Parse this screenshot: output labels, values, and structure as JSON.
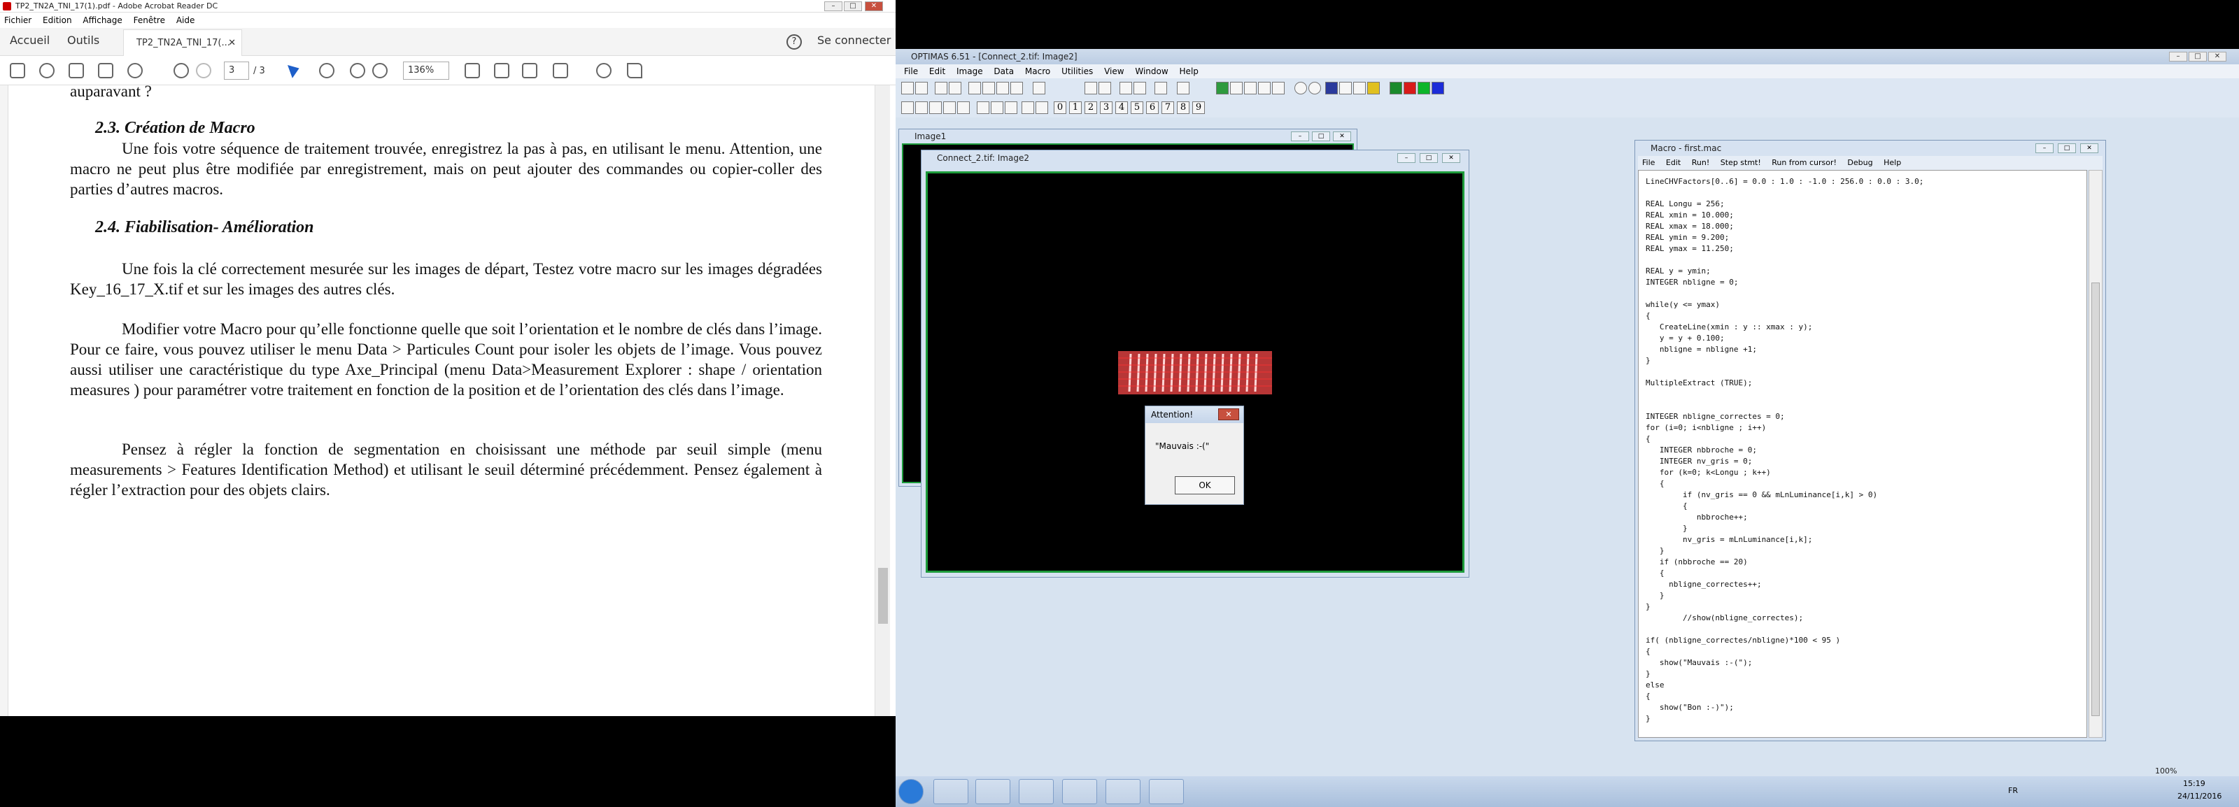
{
  "acrobat": {
    "title": "TP2_TN2A_TNI_17(1).pdf - Adobe Acrobat Reader DC",
    "menu": [
      "Fichier",
      "Edition",
      "Affichage",
      "Fenêtre",
      "Aide"
    ],
    "home_tab": "Accueil",
    "tools_tab": "Outils",
    "doc_tab": "TP2_TN2A_TNI_17(...",
    "signin": "Se connecter",
    "page_current": "3",
    "page_total": "/ 3",
    "zoom": "136%",
    "content": {
      "cut_top": "auparavant ?",
      "h1": "2.3. Création de Macro",
      "p1": "Une fois votre séquence de traitement trouvée, enregistrez la pas à pas, en utilisant le menu. Attention, une macro ne peut plus être modifiée par enregistrement, mais on peut ajouter des commandes ou copier-coller des parties d’autres macros.",
      "h2": "2.4. Fiabilisation- Amélioration",
      "p2": "Une fois la clé correctement mesurée sur les images de départ, Testez votre macro sur les images dégradées Key_16_17_X.tif et sur les images des autres clés.",
      "p3": "Modifier votre Macro pour qu’elle fonctionne quelle que soit l’orientation et le nombre de clés dans l’image. Pour ce faire, vous pouvez utiliser le menu Data > Particules Count pour isoler les objets de l’image. Vous pouvez aussi utiliser une caractéristique du type Axe_Principal (menu Data>Measurement Explorer : shape / orientation measures ) pour paramétrer votre traitement en fonction de la position et de l’orientation des clés dans l’image.",
      "p4": "Pensez à régler la fonction de segmentation en choisissant une méthode par seuil simple (menu measurements > Features Identification Method) et utilisant le seuil déterminé précédemment. Pensez également à régler l’extraction pour des objets clairs."
    }
  },
  "optimas": {
    "title": "OPTIMAS 6.51 - [Connect_2.tif: Image2]",
    "menu": [
      "File",
      "Edit",
      "Image",
      "Data",
      "Macro",
      "Utilities",
      "View",
      "Window",
      "Help"
    ],
    "num_buttons": [
      "0",
      "1",
      "2",
      "3",
      "4",
      "5",
      "6",
      "7",
      "8",
      "9"
    ],
    "image1_title": "Image1",
    "image2_title": "Connect_2.tif: Image2",
    "alert": {
      "title": "Attention!",
      "message": "\"Mauvais :-(\"",
      "ok": "OK"
    },
    "macro": {
      "title": "Macro - first.mac",
      "menu": [
        "File",
        "Edit",
        "Run!",
        "Step stmt!",
        "Run from cursor!",
        "Debug",
        "Help"
      ],
      "code": "LineCHVFactors[0..6] = 0.0 : 1.0 : -1.0 : 256.0 : 0.0 : 3.0;\n\nREAL Longu = 256;\nREAL xmin = 10.000;\nREAL xmax = 18.000;\nREAL ymin = 9.200;\nREAL ymax = 11.250;\n\nREAL y = ymin;\nINTEGER nbligne = 0;\n\nwhile(y <= ymax)\n{\n   CreateLine(xmin : y :: xmax : y);\n   y = y + 0.100;\n   nbligne = nbligne +1;\n}\n\nMultipleExtract (TRUE);\n\n\nINTEGER nbligne_correctes = 0;\nfor (i=0; i<nbligne ; i++)\n{\n   INTEGER nbbroche = 0;\n   INTEGER nv_gris = 0;\n   for (k=0; k<Longu ; k++)\n   {\n        if (nv_gris == 0 && mLnLuminance[i,k] > 0)\n        {\n           nbbroche++;\n        }\n        nv_gris = mLnLuminance[i,k];\n   }\n   if (nbbroche == 20)\n   {\n     nbligne_correctes++;\n   }\n}\n        //show(nbligne_correctes);\n\nif( (nbligne_correctes/nbligne)*100 < 95 )\n{\n   show(\"Mauvais :-(\");\n}\nelse\n{\n   show(\"Bon :-)\");\n}"
    },
    "zoom_label": "100%"
  },
  "taskbar": {
    "lang": "FR",
    "time": "15:19",
    "date": "24/11/2016"
  }
}
